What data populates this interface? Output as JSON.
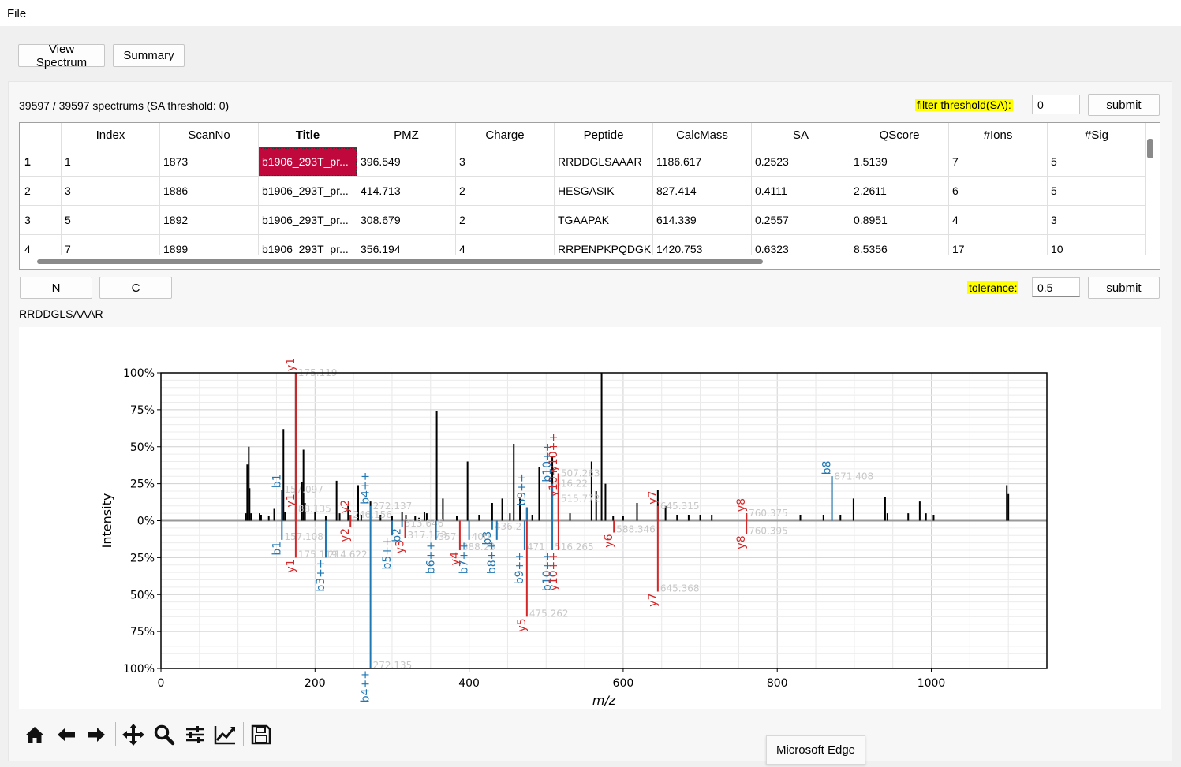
{
  "menu": {
    "file": "File"
  },
  "tabs": {
    "view_spectrum": "View Spectrum",
    "summary": "Summary"
  },
  "filter": {
    "count_text": "39597 / 39597 spectrums (SA threshold: 0)",
    "label": "filter threshold(SA):",
    "value": "0",
    "submit": "submit"
  },
  "table": {
    "columns": [
      "Index",
      "ScanNo",
      "Title",
      "PMZ",
      "Charge",
      "Peptide",
      "CalcMass",
      "SA",
      "QScore",
      "#Ions",
      "#Sig"
    ],
    "rows": [
      {
        "num": "1",
        "cells": [
          "1",
          "1873",
          "b1906_293T_pr...",
          "396.549",
          "3",
          "RRDDGLSAAAR",
          "1186.617",
          "0.2523",
          "1.5139",
          "7",
          "5"
        ]
      },
      {
        "num": "2",
        "cells": [
          "3",
          "1886",
          "b1906_293T_pr...",
          "414.713",
          "2",
          "HESGASIK",
          "827.414",
          "0.4111",
          "2.2611",
          "6",
          "5"
        ]
      },
      {
        "num": "3",
        "cells": [
          "5",
          "1892",
          "b1906_293T_pr...",
          "308.679",
          "2",
          "TGAAPAK",
          "614.339",
          "0.2557",
          "0.8951",
          "4",
          "3"
        ]
      },
      {
        "num": "4",
        "cells": [
          "7",
          "1899",
          "b1906_293T_pr...",
          "356.194",
          "4",
          "RRPENPKPQDGK",
          "1420.753",
          "0.6323",
          "8.5356",
          "17",
          "10"
        ]
      }
    ],
    "selected": {
      "row": 0,
      "col": 2
    }
  },
  "terminus": {
    "n": "N",
    "c": "C"
  },
  "tolerance": {
    "label": "tolerance:",
    "value": "0.5",
    "submit": "submit"
  },
  "peptide_label": "RRDDGLSAAAR",
  "tooltip": "Microsoft Edge",
  "toolbar": [
    "home-icon",
    "back-icon",
    "forward-icon",
    "pan-icon",
    "zoom-icon",
    "configure-icon",
    "edit-curve-icon",
    "save-icon"
  ],
  "chart_data": {
    "type": "bar",
    "xlabel": "m/z",
    "ylabel": "Intensity",
    "xlim": [
      0,
      1150
    ],
    "ylim": [
      -100,
      100
    ],
    "x_ticks": [
      0,
      200,
      400,
      600,
      800,
      1000
    ],
    "y_ticks": [
      100,
      75,
      50,
      25,
      0,
      -25,
      -50,
      -75,
      -100
    ],
    "y_tick_labels": [
      "100%",
      "75%",
      "50%",
      "25%",
      "0%",
      "25%",
      "50%",
      "75%",
      "100%"
    ],
    "grid": true,
    "colors": {
      "b": "#1f77b4",
      "y": "#d62728",
      "other": "#000000"
    },
    "experimental_peaks": [
      {
        "mz": 110,
        "i": 5
      },
      {
        "mz": 112,
        "i": 38
      },
      {
        "mz": 114,
        "i": 50
      },
      {
        "mz": 115,
        "i": 22
      },
      {
        "mz": 117,
        "i": 5
      },
      {
        "mz": 128,
        "i": 5
      },
      {
        "mz": 130,
        "i": 4
      },
      {
        "mz": 140,
        "i": 3
      },
      {
        "mz": 147,
        "i": 8
      },
      {
        "mz": 157,
        "i": 21
      },
      {
        "mz": 159,
        "i": 62
      },
      {
        "mz": 161,
        "i": 6
      },
      {
        "mz": 175,
        "i": 100
      },
      {
        "mz": 183,
        "i": 26
      },
      {
        "mz": 185,
        "i": 48
      },
      {
        "mz": 187,
        "i": 12
      },
      {
        "mz": 200,
        "i": 6
      },
      {
        "mz": 214,
        "i": 3
      },
      {
        "mz": 228,
        "i": 27
      },
      {
        "mz": 232,
        "i": 5
      },
      {
        "mz": 243,
        "i": 10
      },
      {
        "mz": 246,
        "i": 4
      },
      {
        "mz": 256,
        "i": 24
      },
      {
        "mz": 260,
        "i": 4
      },
      {
        "mz": 272,
        "i": 13
      },
      {
        "mz": 285,
        "i": 4
      },
      {
        "mz": 300,
        "i": 3
      },
      {
        "mz": 313,
        "i": 6
      },
      {
        "mz": 318,
        "i": 4
      },
      {
        "mz": 330,
        "i": 3
      },
      {
        "mz": 335,
        "i": 2
      },
      {
        "mz": 342,
        "i": 6
      },
      {
        "mz": 345,
        "i": 5
      },
      {
        "mz": 358,
        "i": 74
      },
      {
        "mz": 366,
        "i": 15
      },
      {
        "mz": 384,
        "i": 3
      },
      {
        "mz": 398,
        "i": 40
      },
      {
        "mz": 413,
        "i": 4
      },
      {
        "mz": 430,
        "i": 12
      },
      {
        "mz": 443,
        "i": 15
      },
      {
        "mz": 453,
        "i": 5
      },
      {
        "mz": 458,
        "i": 52
      },
      {
        "mz": 466,
        "i": 15
      },
      {
        "mz": 475,
        "i": 9
      },
      {
        "mz": 482,
        "i": 4
      },
      {
        "mz": 491,
        "i": 36
      },
      {
        "mz": 508,
        "i": 44
      },
      {
        "mz": 516,
        "i": 32
      },
      {
        "mz": 531,
        "i": 5
      },
      {
        "mz": 559,
        "i": 40
      },
      {
        "mz": 565,
        "i": 20
      },
      {
        "mz": 572,
        "i": 100
      },
      {
        "mz": 577,
        "i": 25
      },
      {
        "mz": 587,
        "i": 3
      },
      {
        "mz": 600,
        "i": 3
      },
      {
        "mz": 618,
        "i": 12
      },
      {
        "mz": 645,
        "i": 21
      },
      {
        "mz": 655,
        "i": 10
      },
      {
        "mz": 670,
        "i": 4
      },
      {
        "mz": 685,
        "i": 4
      },
      {
        "mz": 700,
        "i": 4
      },
      {
        "mz": 715,
        "i": 4
      },
      {
        "mz": 760,
        "i": 5
      },
      {
        "mz": 830,
        "i": 4
      },
      {
        "mz": 860,
        "i": 4
      },
      {
        "mz": 871,
        "i": 30
      },
      {
        "mz": 882,
        "i": 4
      },
      {
        "mz": 899,
        "i": 15
      },
      {
        "mz": 940,
        "i": 16
      },
      {
        "mz": 943,
        "i": 5
      },
      {
        "mz": 970,
        "i": 5
      },
      {
        "mz": 985,
        "i": 13
      },
      {
        "mz": 993,
        "i": 5
      },
      {
        "mz": 1003,
        "i": 4
      },
      {
        "mz": 1098,
        "i": 24
      },
      {
        "mz": 1100,
        "i": 18
      }
    ],
    "matched_ions": [
      {
        "label": "b1",
        "mz": 157,
        "i": 21,
        "ion": "b",
        "mzlabel": "157.097"
      },
      {
        "label": "y1",
        "mz": 175,
        "i": 100,
        "ion": "y",
        "mzlabel": "175.119"
      },
      {
        "label": "y1",
        "mz": 175,
        "i": 8,
        "ion": "y",
        "mzlabel": "88.135"
      },
      {
        "label": "y2",
        "mz": 246,
        "i": 4,
        "ion": "y",
        "mzlabel": "246.156"
      },
      {
        "label": "b4++",
        "mz": 272,
        "i": 10,
        "ion": "b",
        "mzlabel": "272.137"
      },
      {
        "label": "b9++",
        "mz": 475,
        "i": 9,
        "ion": "b",
        "mzlabel": ""
      },
      {
        "label": "b10++",
        "mz": 508,
        "i": 25,
        "ion": "b",
        "mzlabel": "516.22"
      },
      {
        "label": "y10++",
        "mz": 516,
        "i": 32,
        "ion": "y",
        "mzlabel": "507.263"
      },
      {
        "label": "y10+",
        "mz": 516,
        "i": 15,
        "ion": "y",
        "mzlabel": "515.772"
      },
      {
        "label": "y7",
        "mz": 645,
        "i": 10,
        "ion": "y",
        "mzlabel": "645.315"
      },
      {
        "label": "y8",
        "mz": 760,
        "i": 5,
        "ion": "y",
        "mzlabel": "760.375"
      },
      {
        "label": "b8",
        "mz": 871,
        "i": 30,
        "ion": "b",
        "mzlabel": "871.408"
      }
    ],
    "theoretical_ions": [
      {
        "label": "b1",
        "mz": 157,
        "i": -13,
        "ion": "b",
        "mzlabel": "157.108"
      },
      {
        "label": "y1",
        "mz": 175,
        "i": -25,
        "ion": "y",
        "mzlabel": "175.119"
      },
      {
        "label": "b3++",
        "mz": 214,
        "i": -25,
        "ion": "b",
        "mzlabel": "214.622"
      },
      {
        "label": "y2",
        "mz": 246,
        "i": -4,
        "ion": "y",
        "mzlabel": ""
      },
      {
        "label": "b4++",
        "mz": 272,
        "i": -100,
        "ion": "b",
        "mzlabel": "272.135"
      },
      {
        "label": "b5++",
        "mz": 300,
        "i": -10,
        "ion": "b",
        "mzlabel": ""
      },
      {
        "label": "b2",
        "mz": 313,
        "i": -4,
        "ion": "b",
        "mzlabel": "313.646"
      },
      {
        "label": "y3",
        "mz": 317,
        "i": -12,
        "ion": "y",
        "mzlabel": "317.173"
      },
      {
        "label": "b6++",
        "mz": 357,
        "i": -13,
        "ion": "b",
        "mzlabel": "357"
      },
      {
        "label": "y4",
        "mz": 388,
        "i": -20,
        "ion": "y",
        "mzlabel": "388.23"
      },
      {
        "label": "b7++",
        "mz": 400,
        "i": -13,
        "ion": "b",
        "mzlabel": "400"
      },
      {
        "label": "b3",
        "mz": 430,
        "i": -6,
        "ion": "b",
        "mzlabel": "436.2"
      },
      {
        "label": "b8++",
        "mz": 436,
        "i": -13,
        "ion": "b",
        "mzlabel": ""
      },
      {
        "label": "b9++",
        "mz": 472,
        "i": -20,
        "ion": "b",
        "mzlabel": "471"
      },
      {
        "label": "y5",
        "mz": 475,
        "i": -65,
        "ion": "y",
        "mzlabel": "475.262"
      },
      {
        "label": "b10++",
        "mz": 508,
        "i": -20,
        "ion": "b",
        "mzlabel": "516.265"
      },
      {
        "label": "y10++",
        "mz": 516,
        "i": -20,
        "ion": "y",
        "mzlabel": ""
      },
      {
        "label": "y6",
        "mz": 588,
        "i": -8,
        "ion": "y",
        "mzlabel": "588.346"
      },
      {
        "label": "y7",
        "mz": 645,
        "i": -48,
        "ion": "y",
        "mzlabel": "645.368"
      },
      {
        "label": "y8",
        "mz": 760,
        "i": -9,
        "ion": "y",
        "mzlabel": "760.395"
      }
    ]
  }
}
